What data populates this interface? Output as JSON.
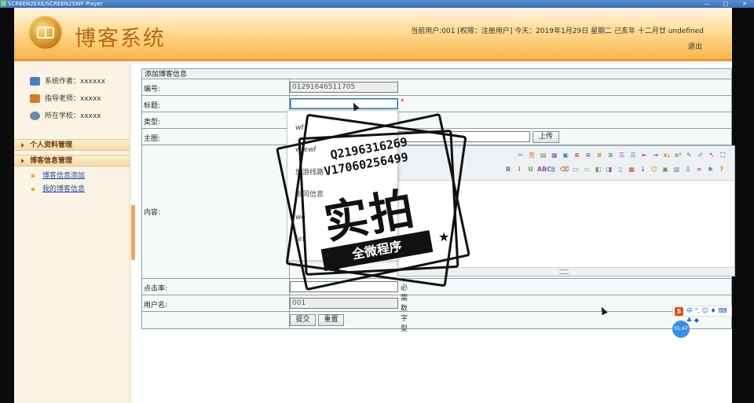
{
  "window": {
    "title": "SCREEN2EXE/SCREEN2SWF Player",
    "controls": [
      "—",
      "□",
      "✕"
    ]
  },
  "header": {
    "title": "博客系统",
    "user_info": "当前用户:001 [权限：注册用户] 今天：2019年1月29日 星期二 己亥年 十二月廿 undefined",
    "logout": "退出"
  },
  "sidebar": {
    "info": [
      {
        "label": "系统作者：xxxxxx",
        "icon": "users-icon",
        "color": "#4a7fc4"
      },
      {
        "label": "指导老师：xxxxx",
        "icon": "teacher-icon",
        "color": "#d9772b"
      },
      {
        "label": "所在学校：xxxxx",
        "icon": "school-icon",
        "color": "#6b8aa8"
      }
    ],
    "menus": [
      {
        "label": "个人资料管理",
        "items": []
      },
      {
        "label": "博客信息管理",
        "items": [
          "博客信息添加",
          "我的博客信息"
        ]
      }
    ]
  },
  "form": {
    "panel_title": "添加博客信息",
    "labels": {
      "number": "编号:",
      "title": "标题:",
      "type": "类型:",
      "image": "主图:",
      "content": "内容:",
      "clicks": "点击率:",
      "username": "用户名:"
    },
    "number_value": "01291646511705",
    "title_value": "",
    "image_value": "",
    "clicks_value": "",
    "clicks_hint": "必需数字型",
    "username_value": "001",
    "upload_label": "上传",
    "required_mark": "*",
    "submit_label": "提交",
    "reset_label": "重置"
  },
  "editor_toolbar_row1": [
    "✂",
    "⎘",
    "▤",
    "▦",
    "▣",
    "≡",
    "≡",
    "≡",
    "≡",
    "☰",
    "☰",
    "⇤",
    "⇥",
    "x₂",
    "x²",
    "✎",
    "✐",
    "↖",
    "⛶"
  ],
  "editor_toolbar_row2": [
    "B",
    "I",
    "U",
    "ABC",
    "≣",
    "⌫",
    "▭",
    "▭",
    "◧",
    "◨",
    "▯",
    "▦",
    "↓",
    "☺",
    "▣",
    "▥",
    "⚓",
    "∞",
    "✱",
    "?"
  ],
  "autocomplete": {
    "items": [
      "wf",
      "wfewf",
      "旅游线路",
      "相同信息",
      "we",
      "fef"
    ]
  },
  "watermark": {
    "line1": "Q2196316269",
    "line2": "V17060256499",
    "big_text": "实拍",
    "ribbon": "全微程序"
  },
  "ime": {
    "label": "中 °, ☺ ♦ ⌨ ♣ ◆",
    "time": "01:47"
  }
}
